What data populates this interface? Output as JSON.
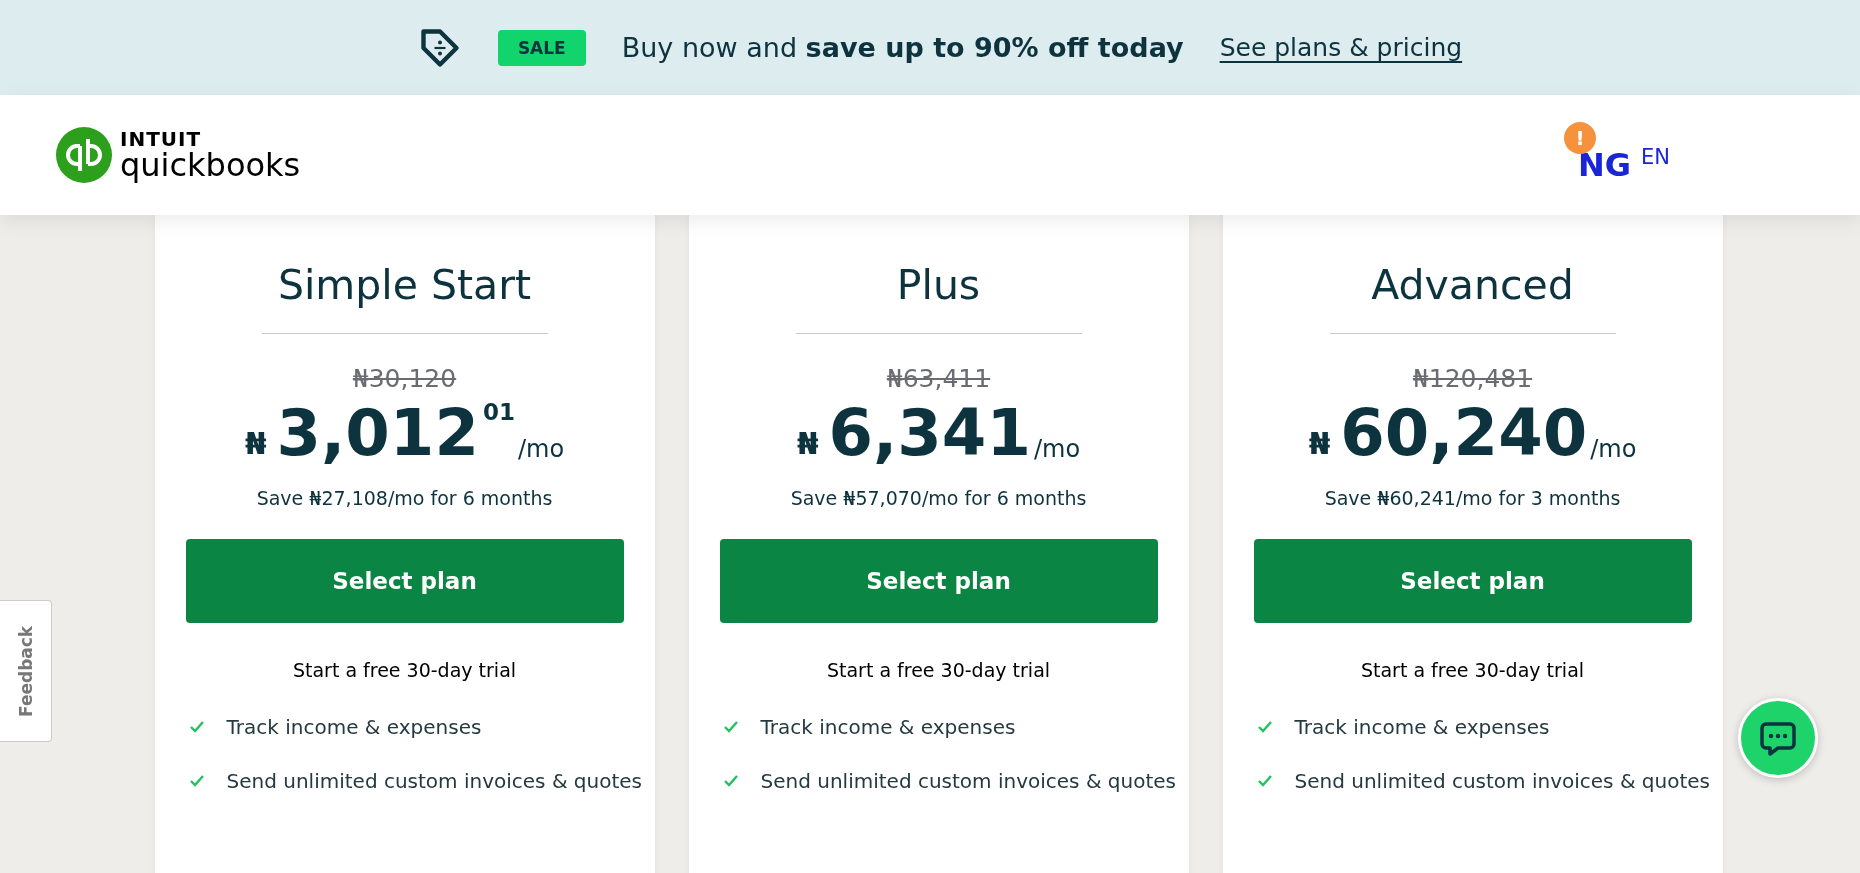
{
  "banner": {
    "badge": "SALE",
    "message": "Buy now and **save up to 90% off today**",
    "link": "See plans & pricing"
  },
  "header": {
    "brand_top": "INTUIT",
    "brand": "quickbooks",
    "region": {
      "alert": "!",
      "country": "NG",
      "language": "EN"
    }
  },
  "plans": [
    {
      "name": "Simple Start",
      "old_price": "₦30,120",
      "currency": "₦",
      "price": "3,012",
      "cents": "01",
      "per": "/mo",
      "savings": "Save ₦27,108/mo for 6 months",
      "button": "Select plan",
      "trial": "Start a free 30-day trial",
      "features": [
        "Track income & expenses",
        "Send unlimited custom invoices & quotes"
      ]
    },
    {
      "name": "Plus",
      "old_price": "₦63,411",
      "currency": "₦",
      "price": "6,341",
      "per": "/mo",
      "savings": "Save ₦57,070/mo for 6 months",
      "button": "Select plan",
      "trial": "Start a free 30-day trial",
      "features": [
        "Track income & expenses",
        "Send unlimited custom invoices & quotes"
      ]
    },
    {
      "name": "Advanced",
      "old_price": "₦120,481",
      "currency": "₦",
      "price": "60,240",
      "per": "/mo",
      "savings": "Save ₦60,241/mo for 3 months",
      "button": "Select plan",
      "trial": "Start a free 30-day trial",
      "features": [
        "Track income & expenses",
        "Send unlimited custom invoices & quotes"
      ]
    }
  ],
  "feedback_tab": "Feedback"
}
